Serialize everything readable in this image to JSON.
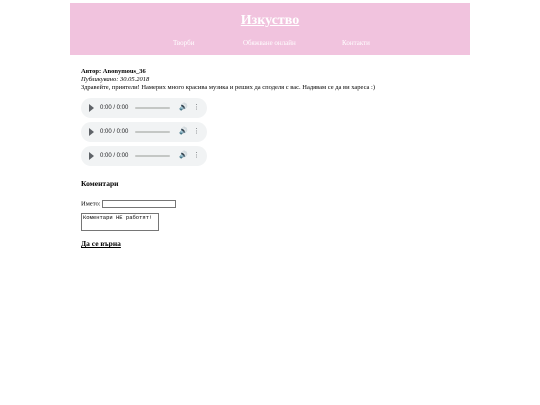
{
  "header": {
    "title": "Изкуство",
    "nav": [
      "Творби",
      "Обяжване онлайн",
      "Контакти"
    ],
    "background": "#f1c3de"
  },
  "post": {
    "author": "Автор: Anonymous_36",
    "published": "Публикувано: 30.05.2018",
    "body": "Здравейте, приятели! Намерих много красива музика и реших да споделя с вас. Надявам се да ви хареса :)"
  },
  "audio_players": [
    {
      "time": "0:00 / 0:00"
    },
    {
      "time": "0:00 / 0:00"
    },
    {
      "time": "0:00 / 0:00"
    }
  ],
  "comments": {
    "title": "Коментари",
    "name_label": "Името:",
    "name_value": "",
    "textarea_text": "Коментари НЕ работят!"
  },
  "back_link": "Да се върна"
}
